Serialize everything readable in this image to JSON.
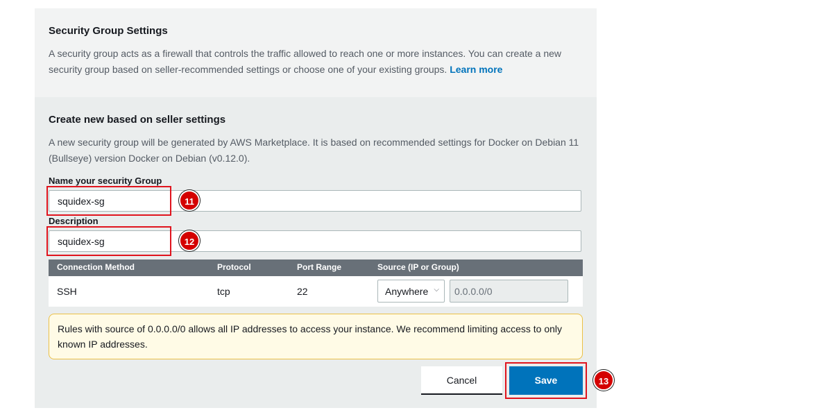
{
  "settings": {
    "title": "Security Group Settings",
    "description": "A security group acts as a firewall that controls the traffic allowed to reach one or more instances. You can create a new security group based on seller-recommended settings or choose one of your existing groups.",
    "learn_more": "Learn more"
  },
  "create": {
    "title": "Create new based on seller settings",
    "description": "A new security group will be generated by AWS Marketplace. It is based on recommended settings for Docker on Debian 11 (Bullseye) version Docker on Debian (v0.12.0)."
  },
  "name_field": {
    "label": "Name your security Group",
    "value": "squidex-sg"
  },
  "description_field": {
    "label": "Description",
    "value": "squidex-sg"
  },
  "table": {
    "headers": [
      "Connection Method",
      "Protocol",
      "Port Range",
      "Source (IP or Group)"
    ],
    "rows": [
      {
        "method": "SSH",
        "protocol": "tcp",
        "port": "22",
        "source_select": "Anywhere",
        "cidr": "0.0.0.0/0"
      }
    ]
  },
  "warning": "Rules with source of 0.0.0.0/0 allows all IP addresses to access your instance. We recommend limiting access to only known IP addresses.",
  "buttons": {
    "cancel": "Cancel",
    "save": "Save"
  },
  "markers": [
    "11",
    "12",
    "13"
  ],
  "colors": {
    "primary": "#0073bb",
    "highlight": "#e0141e",
    "marker": "#d40000",
    "warning_bg": "#fffbe6"
  }
}
